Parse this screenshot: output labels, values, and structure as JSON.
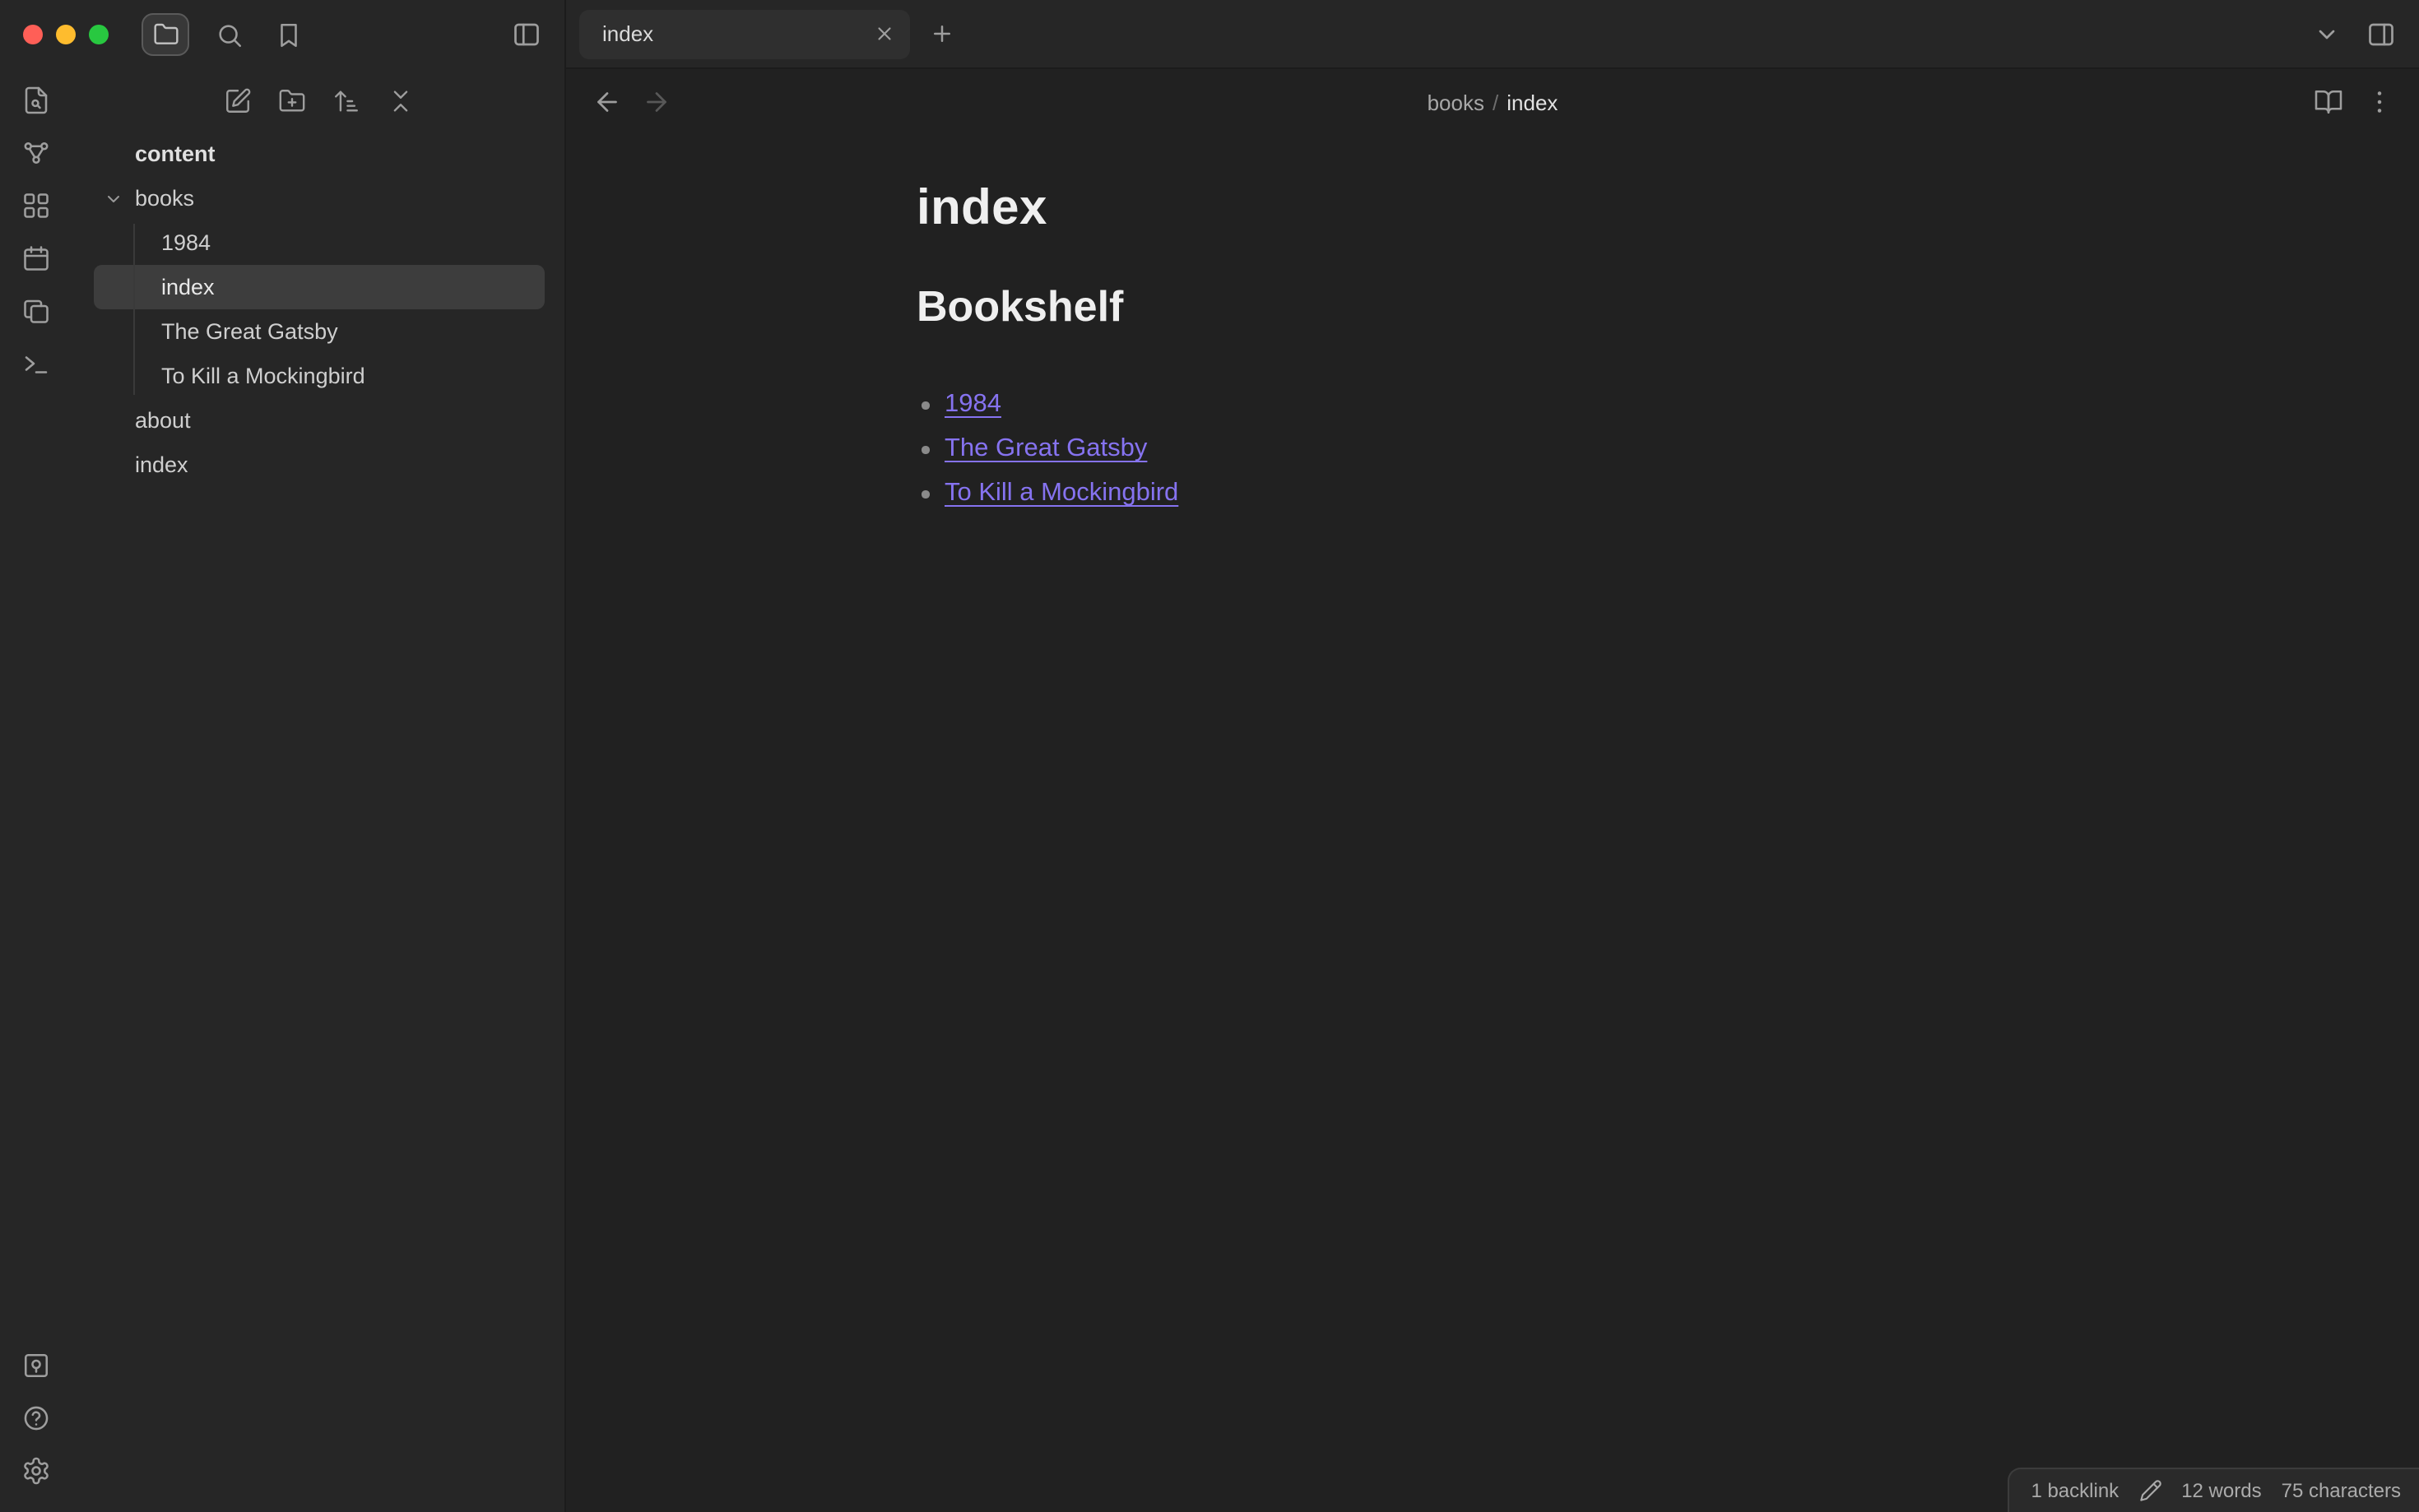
{
  "colors": {
    "accent_link": "#8673f0",
    "chrome_bg": "#262626",
    "editor_bg": "#212121",
    "selected_row_bg": "#3d3d3d",
    "traffic_red": "#ff5f57",
    "traffic_yellow": "#febc2e",
    "traffic_green": "#28c840"
  },
  "titlebar": {
    "active_tab": "index"
  },
  "icons": {
    "titlebar": [
      "folder-icon",
      "search-icon",
      "bookmark-icon",
      "panel-left-icon",
      "close-icon",
      "plus-icon",
      "chevron-down-icon",
      "panel-right-icon"
    ],
    "ribbon_top": [
      "file-search-icon",
      "graph-icon",
      "layout-grid-icon",
      "calendar-icon",
      "files-icon",
      "terminal-icon"
    ],
    "ribbon_bottom": [
      "vault-icon",
      "help-icon",
      "settings-gear-icon"
    ],
    "explorer_toolbar": [
      "new-note-icon",
      "new-folder-icon",
      "sort-order-icon",
      "collapse-all-icon"
    ],
    "view_header": [
      "arrow-left-icon",
      "arrow-right-icon",
      "book-open-icon",
      "more-vertical-icon"
    ],
    "statusbar": [
      "pencil-icon"
    ]
  },
  "sidebar": {
    "vault_name": "content",
    "items": [
      {
        "label": "books",
        "type": "folder",
        "expanded": true
      },
      {
        "label": "1984",
        "type": "file",
        "parent": "books"
      },
      {
        "label": "index",
        "type": "file",
        "parent": "books",
        "selected": true
      },
      {
        "label": "The Great Gatsby",
        "type": "file",
        "parent": "books"
      },
      {
        "label": "To Kill a Mockingbird",
        "type": "file",
        "parent": "books"
      },
      {
        "label": "about",
        "type": "file"
      },
      {
        "label": "index",
        "type": "file"
      }
    ]
  },
  "main": {
    "breadcrumb": {
      "parent": "books",
      "separator": "/",
      "current": "index"
    },
    "note": {
      "title": "index",
      "heading": "Bookshelf",
      "links": [
        "1984",
        "The Great Gatsby",
        "To Kill a Mockingbird"
      ]
    }
  },
  "statusbar": {
    "backlinks": "1 backlink",
    "words": "12 words",
    "characters": "75 characters"
  }
}
